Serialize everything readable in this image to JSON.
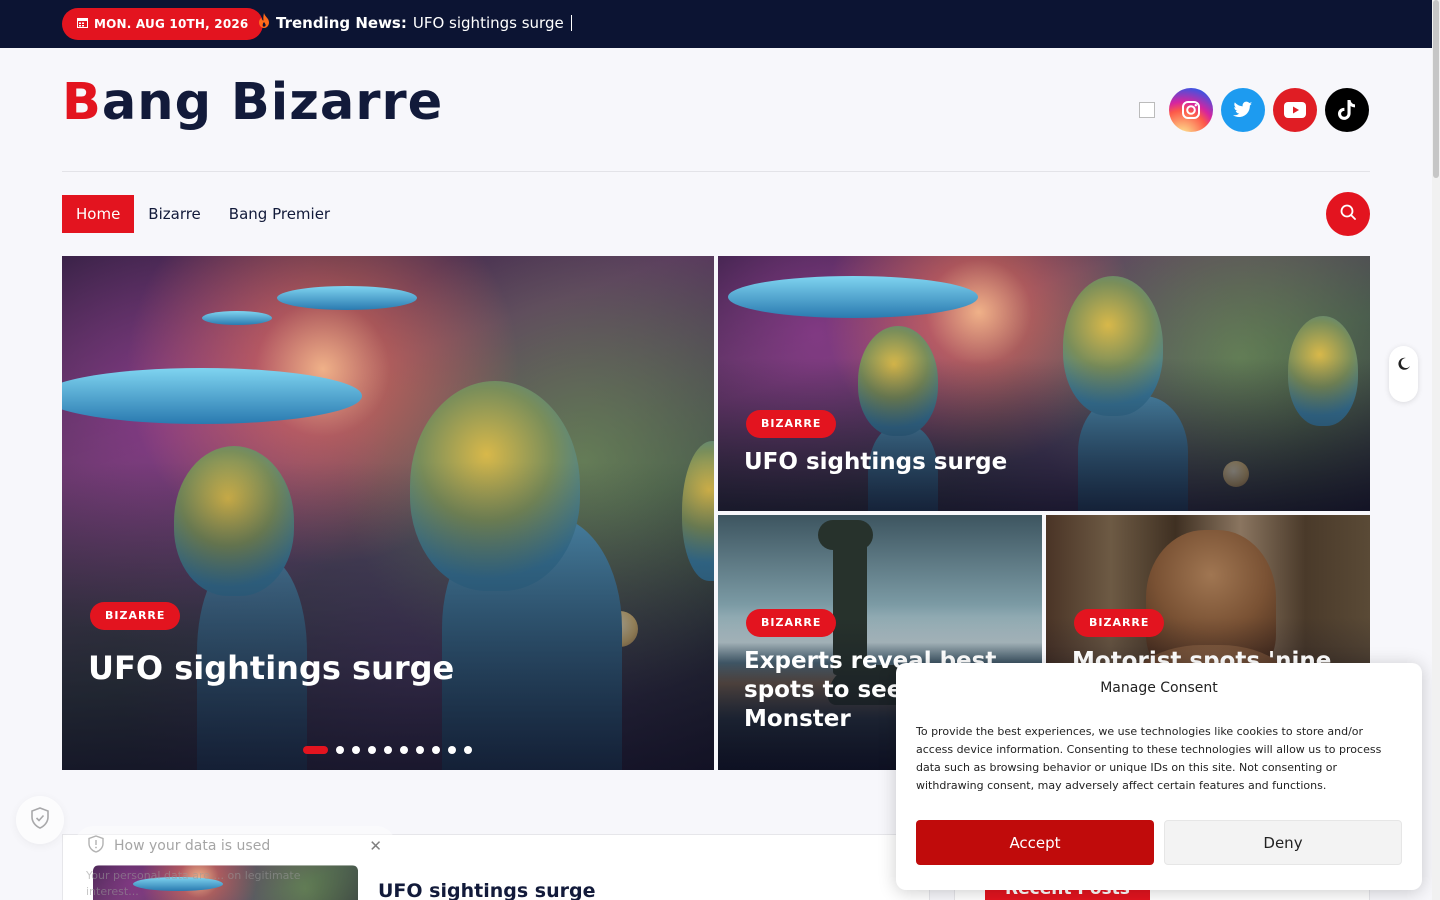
{
  "topbar": {
    "date": "MON. AUG 10TH, 2026",
    "trending_label": "Trending News:",
    "trending_text": "UFO sightings surge"
  },
  "header": {
    "logo_first": "B",
    "logo_rest": "ang Bizarre"
  },
  "socials": [
    "instagram-icon",
    "twitter-icon",
    "youtube-icon",
    "tiktok-icon"
  ],
  "nav": {
    "items": [
      {
        "label": "Home",
        "active": true
      },
      {
        "label": "Bizarre"
      },
      {
        "label": "Bang Premier"
      }
    ]
  },
  "hero": {
    "main": {
      "category": "BIZARRE",
      "title": "UFO sightings surge"
    },
    "slide_count": 10,
    "active_slide": 1,
    "top_right": {
      "category": "BIZARRE",
      "title": "UFO sightings surge"
    },
    "bottom_left": {
      "category": "BIZARRE",
      "title": "Experts reveal best spots to see L Monster"
    },
    "bottom_right": {
      "category": "BIZARRE",
      "title": "Motorist spots 'nine"
    }
  },
  "content": {
    "post_title": "UFO sightings surge",
    "recent_posts": "Recent Posts"
  },
  "privacy_widget": {
    "tip": "How your data is used",
    "faded_text": "Your personal data are ... on legitimate interest..."
  },
  "consent": {
    "title": "Manage Consent",
    "body": "To provide the best experiences, we use technologies like cookies to store and/or access device information. Consenting to these technologies will allow us to process data such as browsing behavior or unique IDs on this site. Not consenting or withdrawing consent, may adversely affect certain features and functions.",
    "accept": "Accept",
    "deny": "Deny"
  },
  "colors": {
    "accent": "#e3141f",
    "topbar": "#0c1433",
    "accept_button": "#c00b0b"
  }
}
